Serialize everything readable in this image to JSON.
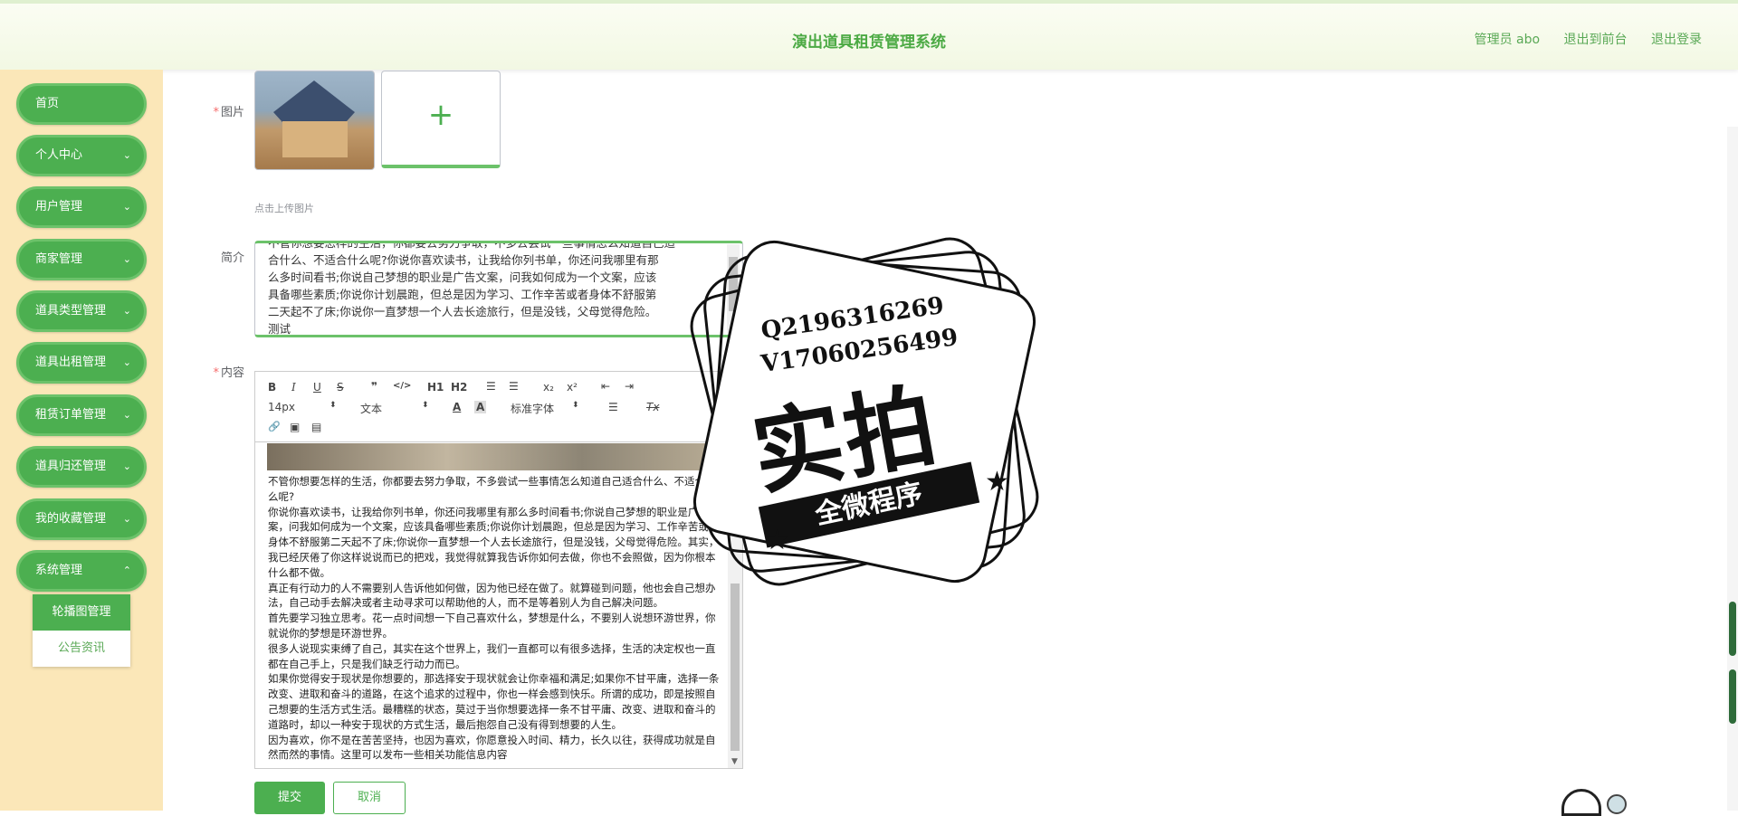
{
  "header": {
    "title": "演出道具租赁管理系统",
    "admin": "管理员 abo",
    "to_front": "退出到前台",
    "logout": "退出登录"
  },
  "sidebar": {
    "items": [
      {
        "label": "首页",
        "chevron": ""
      },
      {
        "label": "个人中心",
        "chevron": "⌄"
      },
      {
        "label": "用户管理",
        "chevron": "⌄"
      },
      {
        "label": "商家管理",
        "chevron": "⌄"
      },
      {
        "label": "道具类型管理",
        "chevron": "⌄"
      },
      {
        "label": "道具出租管理",
        "chevron": "⌄"
      },
      {
        "label": "租赁订单管理",
        "chevron": "⌄"
      },
      {
        "label": "道具归还管理",
        "chevron": "⌄"
      },
      {
        "label": "我的收藏管理",
        "chevron": "⌄"
      },
      {
        "label": "系统管理",
        "chevron": "⌃"
      }
    ],
    "submenu": [
      {
        "label": "轮播图管理",
        "active": true
      },
      {
        "label": "公告资讯",
        "active": false
      }
    ]
  },
  "form": {
    "image_label": "图片",
    "upload_tip": "点击上传图片",
    "upload_plus": "+",
    "intro_label": "简介",
    "intro_lines": [
      "不管你想要怎样的生活，你都要去努力争取，不多去尝试一些事情怎么知道自己适",
      "合什么、不适合什么呢?你说你喜欢读书，让我给你列书单，你还问我哪里有那",
      "么多时间看书;你说自己梦想的职业是广告文案，问我如何成为一个文案，应该",
      "具备哪些素质;你说你计划晨跑，但总是因为学习、工作辛苦或者身体不舒服第",
      "二天起不了床;你说你一直梦想一个人去长途旅行，但是没钱，父母觉得危险。",
      "测试"
    ],
    "content_label": "内容",
    "required_mark": "*",
    "submit": "提交",
    "cancel": "取消"
  },
  "editor": {
    "toolbar": {
      "bold": "B",
      "italic": "I",
      "underline": "U",
      "strike": "S",
      "quote": "❞",
      "code": "</>",
      "h1": "H1",
      "h2": "H2",
      "ol": "☰",
      "ul": "☰",
      "sub": "x₂",
      "sup": "x²",
      "outdent": "⇤",
      "indent": "⇥",
      "size": "14px",
      "format": "文本",
      "font": "标准字体",
      "color": "A",
      "bg": "A",
      "align": "☰",
      "clear": "Tx",
      "link": "🔗",
      "image": "▣",
      "video": "▤",
      "select_arrow": "⬍"
    },
    "paragraphs": [
      "不管你想要怎样的生活，你都要去努力争取，不多尝试一些事情怎么知道自己适合什么、不适合什么呢?",
      "你说你喜欢读书，让我给你列书单，你还问我哪里有那么多时间看书;你说自己梦想的职业是广告文案，问我如何成为一个文案，应该具备哪些素质;你说你计划晨跑，但总是因为学习、工作辛苦或者身体不舒服第二天起不了床;你说你一直梦想一个人去长途旅行，但是没钱，父母觉得危险。其实，我已经厌倦了你这样说说而已的把戏，我觉得就算我告诉你如何去做，你也不会照做，因为你根本什么都不做。",
      "真正有行动力的人不需要别人告诉他如何做，因为他已经在做了。就算碰到问题，他也会自己想办法，自己动手去解决或者主动寻求可以帮助他的人，而不是等着别人为自己解决问题。",
      "首先要学习独立思考。花一点时间想一下自己喜欢什么，梦想是什么，不要别人说想环游世界，你就说你的梦想是环游世界。",
      "很多人说现实束缚了自己，其实在这个世界上，我们一直都可以有很多选择，生活的决定权也一直都在自己手上，只是我们缺乏行动力而已。",
      "如果你觉得安于现状是你想要的，那选择安于现状就会让你幸福和满足;如果你不甘平庸，选择一条改变、进取和奋斗的道路，在这个追求的过程中，你也一样会感到快乐。所谓的成功，即是按照自己想要的生活方式生活。最糟糕的状态，莫过于当你想要选择一条不甘平庸、改变、进取和奋斗的道路时，却以一种安于现状的方式生活，最后抱怨自己没有得到想要的人生。",
      "因为喜欢，你不是在苦苦坚持，也因为喜欢，你愿意投入时间、精力，长久以往，获得成功就是自然而然的事情。这里可以发布一些相关功能信息内容"
    ]
  },
  "watermark": {
    "qq": "Q2196316269",
    "vx": "V17060256499",
    "big": "实拍",
    "ribbon": "全微程序",
    "star": "★"
  },
  "colors": {
    "accent": "#4caf50",
    "sidebar_bg": "#fbe7b8",
    "required": "#f56c6c"
  }
}
